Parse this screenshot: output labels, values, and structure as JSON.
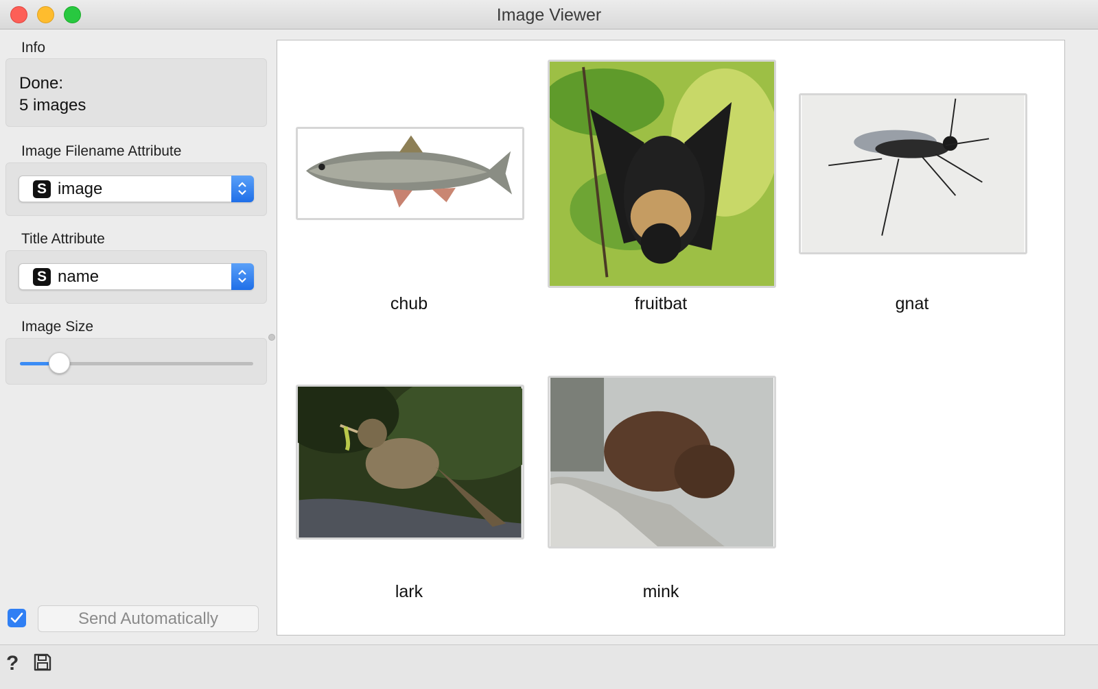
{
  "window": {
    "title": "Image Viewer"
  },
  "info": {
    "label": "Info",
    "status_line1": "Done:",
    "status_line2": "5 images"
  },
  "filename_attribute": {
    "label": "Image Filename Attribute",
    "type_badge": "S",
    "value": "image"
  },
  "title_attribute": {
    "label": "Title Attribute",
    "type_badge": "S",
    "value": "name"
  },
  "image_size": {
    "label": "Image Size",
    "slider_fraction": 0.17
  },
  "send": {
    "checkbox_checked": true,
    "button_label": "Send Automatically"
  },
  "gallery": {
    "items": [
      {
        "title": "chub",
        "image": "fish-photo"
      },
      {
        "title": "fruitbat",
        "image": "bat-photo"
      },
      {
        "title": "gnat",
        "image": "gnat-photo"
      },
      {
        "title": "lark",
        "image": "lark-photo"
      },
      {
        "title": "mink",
        "image": "mink-photo"
      }
    ]
  },
  "icons": {
    "help": "question-mark-icon",
    "save": "floppy-disk-icon"
  },
  "colors": {
    "accent": "#2f7ff4",
    "close": "#fd5f57",
    "minimize": "#febc2e",
    "maximize": "#28c840"
  }
}
